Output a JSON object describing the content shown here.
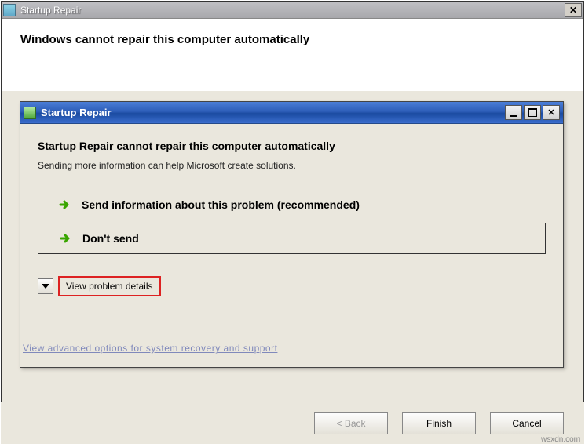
{
  "outer": {
    "title": "Startup Repair",
    "heading": "Windows cannot repair this computer automatically"
  },
  "inner": {
    "title": "Startup Repair",
    "heading": "Startup Repair cannot repair this computer automatically",
    "subtext": "Sending more information can help Microsoft create solutions.",
    "options": {
      "send": "Send information about this problem (recommended)",
      "dont_send": "Don't send"
    },
    "details_label": "View problem details"
  },
  "faint_link": "View advanced options for system recovery and support",
  "footer": {
    "back": "< Back",
    "finish": "Finish",
    "cancel": "Cancel"
  },
  "watermark": "wsxdn.com"
}
